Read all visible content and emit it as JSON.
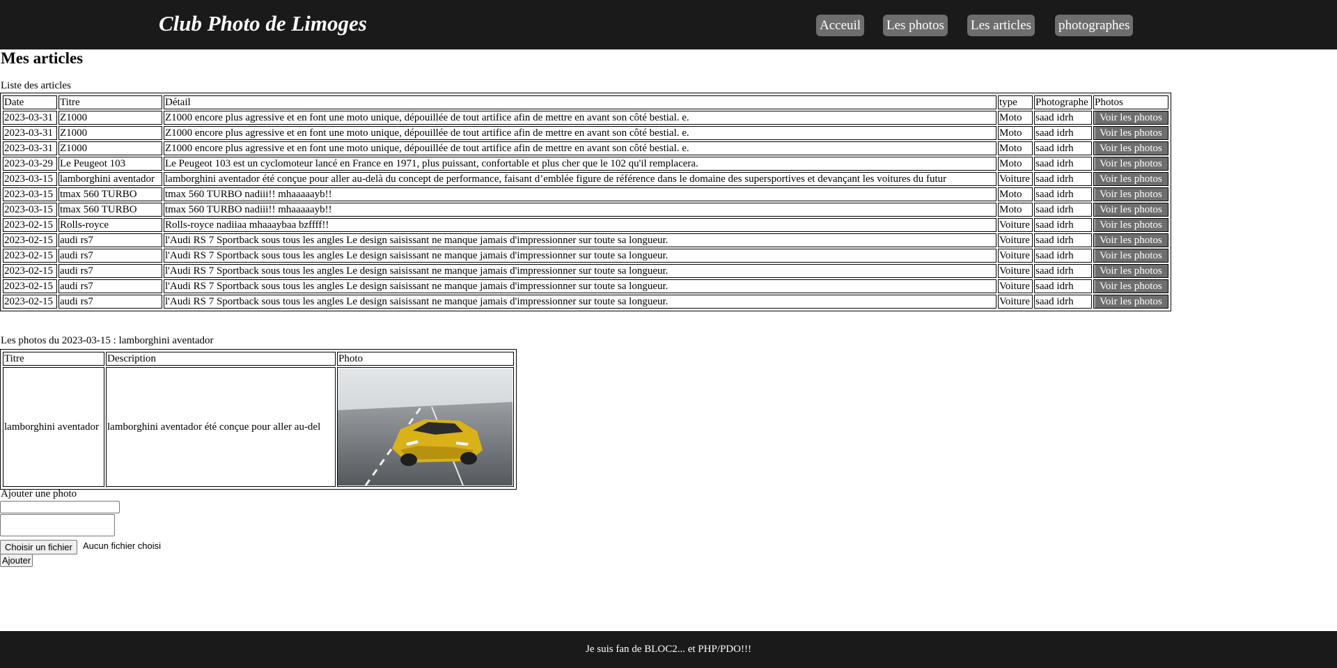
{
  "header": {
    "brand": "Club Photo de Limoges",
    "nav": [
      "Acceuil",
      "Les photos",
      "Les articles",
      "photographes"
    ]
  },
  "page_title": "Mes articles",
  "articles": {
    "caption": "Liste des articles",
    "columns": [
      "Date",
      "Titre",
      "Détail",
      "type",
      "Photographe",
      "Photos"
    ],
    "button_label": "Voir les photos",
    "rows": [
      [
        "2023-03-31",
        "Z1000",
        "Z1000 encore plus agressive et en font une moto unique, dépouillée de tout artifice afin de mettre en avant son côté bestial. e.",
        "Moto",
        "saad idrh"
      ],
      [
        "2023-03-31",
        "Z1000",
        "Z1000 encore plus agressive et en font une moto unique, dépouillée de tout artifice afin de mettre en avant son côté bestial. e.",
        "Moto",
        "saad idrh"
      ],
      [
        "2023-03-31",
        "Z1000",
        "Z1000 encore plus agressive et en font une moto unique, dépouillée de tout artifice afin de mettre en avant son côté bestial. e.",
        "Moto",
        "saad idrh"
      ],
      [
        "2023-03-29",
        "Le Peugeot 103",
        "Le Peugeot 103 est un cyclomoteur lancé en France en 1971, plus puissant, confortable et plus cher que le 102 qu'il remplacera.",
        "Moto",
        "saad idrh"
      ],
      [
        "2023-03-15",
        "lamborghini aventador",
        "lamborghini aventador été conçue pour aller au-delà du concept de performance, faisant d’emblée figure de référence dans le domaine des supersportives et devançant les voitures du futur",
        "Voiture",
        "saad idrh"
      ],
      [
        "2023-03-15",
        "tmax 560 TURBO",
        "tmax 560 TURBO nadiii!! mhaaaaayb!!",
        "Moto",
        "saad idrh"
      ],
      [
        "2023-03-15",
        "tmax 560 TURBO",
        "tmax 560 TURBO nadiii!! mhaaaaayb!!",
        "Moto",
        "saad idrh"
      ],
      [
        "2023-02-15",
        "Rolls-royce",
        "Rolls-royce nadiiaa mhaaaybaa bzffff!!",
        "Voiture",
        "saad idrh"
      ],
      [
        "2023-02-15",
        "audi rs7",
        "l'Audi RS 7 Sportback sous tous les angles Le design saisissant ne manque jamais d'impressionner sur toute sa longueur.",
        "Voiture",
        "saad idrh"
      ],
      [
        "2023-02-15",
        "audi rs7",
        "l'Audi RS 7 Sportback sous tous les angles Le design saisissant ne manque jamais d'impressionner sur toute sa longueur.",
        "Voiture",
        "saad idrh"
      ],
      [
        "2023-02-15",
        "audi rs7",
        "l'Audi RS 7 Sportback sous tous les angles Le design saisissant ne manque jamais d'impressionner sur toute sa longueur.",
        "Voiture",
        "saad idrh"
      ],
      [
        "2023-02-15",
        "audi rs7",
        "l'Audi RS 7 Sportback sous tous les angles Le design saisissant ne manque jamais d'impressionner sur toute sa longueur.",
        "Voiture",
        "saad idrh"
      ],
      [
        "2023-02-15",
        "audi rs7",
        "l'Audi RS 7 Sportback sous tous les angles Le design saisissant ne manque jamais d'impressionner sur toute sa longueur.",
        "Voiture",
        "saad idrh"
      ]
    ]
  },
  "photos": {
    "caption": "Les photos du 2023-03-15 : lamborghini aventador",
    "columns": [
      "Titre",
      "Description",
      "Photo"
    ],
    "row": {
      "title": "lamborghini aventador",
      "description": "lamborghini aventador été conçue pour aller au-del",
      "image_icon": "yellow-sports-car-photo"
    }
  },
  "form": {
    "label": "Ajouter une photo",
    "file_button": "Choisir un fichier",
    "file_status": "Aucun fichier choisi",
    "submit": "Ajouter"
  },
  "footer": "Je suis fan de BLOC2... et PHP/PDO!!!"
}
